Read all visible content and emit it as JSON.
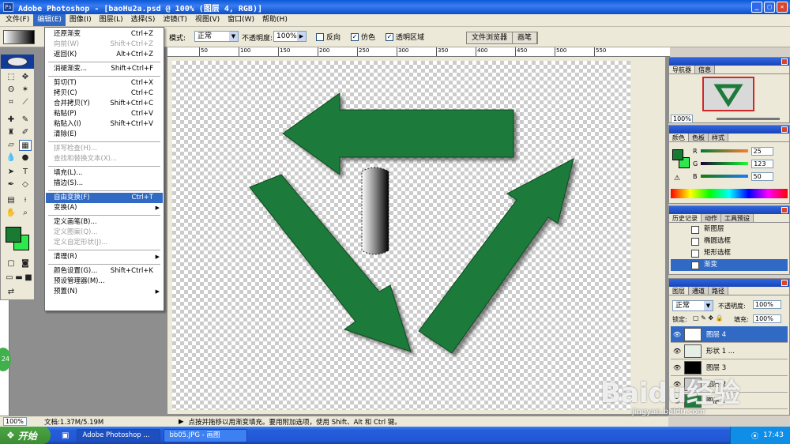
{
  "window": {
    "title": "Adobe Photoshop - [baoHu2a.psd @ 100% (图层 4, RGB)]"
  },
  "menubar": {
    "items": [
      "文件(F)",
      "编辑(E)",
      "图像(I)",
      "图层(L)",
      "选择(S)",
      "滤镜(T)",
      "视图(V)",
      "窗口(W)",
      "帮助(H)"
    ]
  },
  "options": {
    "mode_label": "模式:",
    "mode_value": "正常",
    "opacity_label": "不透明度:",
    "opacity_value": "100%",
    "reverse_label": "反向",
    "dither_label": "仿色",
    "transparency_label": "透明区域",
    "browser_label": "文件浏览器",
    "brushes_label": "画笔"
  },
  "edit_menu": [
    {
      "label": "还原渐变",
      "shortcut": "Ctrl+Z",
      "enabled": true
    },
    {
      "label": "向前(W)",
      "shortcut": "Shift+Ctrl+Z",
      "enabled": false
    },
    {
      "label": "返回(K)",
      "shortcut": "Alt+Ctrl+Z",
      "enabled": true
    },
    {
      "sep": true
    },
    {
      "label": "消褪渐变...",
      "shortcut": "Shift+Ctrl+F",
      "enabled": true
    },
    {
      "sep": true
    },
    {
      "label": "剪切(T)",
      "shortcut": "Ctrl+X",
      "enabled": true
    },
    {
      "label": "拷贝(C)",
      "shortcut": "Ctrl+C",
      "enabled": true
    },
    {
      "label": "合并拷贝(Y)",
      "shortcut": "Shift+Ctrl+C",
      "enabled": true
    },
    {
      "label": "粘贴(P)",
      "shortcut": "Ctrl+V",
      "enabled": true
    },
    {
      "label": "粘贴入(I)",
      "shortcut": "Shift+Ctrl+V",
      "enabled": true
    },
    {
      "label": "清除(E)",
      "shortcut": "",
      "enabled": true
    },
    {
      "sep": true
    },
    {
      "label": "拼写检查(H)...",
      "shortcut": "",
      "enabled": false
    },
    {
      "label": "查找和替换文本(X)...",
      "shortcut": "",
      "enabled": false
    },
    {
      "sep": true
    },
    {
      "label": "填充(L)...",
      "shortcut": "",
      "enabled": true
    },
    {
      "label": "描边(S)...",
      "shortcut": "",
      "enabled": true
    },
    {
      "sep": true
    },
    {
      "label": "自由变换(F)",
      "shortcut": "Ctrl+T",
      "enabled": true,
      "highlight": true
    },
    {
      "label": "变换(A)",
      "shortcut": "",
      "enabled": true,
      "submenu": true
    },
    {
      "sep": true
    },
    {
      "label": "定义画笔(B)...",
      "shortcut": "",
      "enabled": true
    },
    {
      "label": "定义图案(Q)...",
      "shortcut": "",
      "enabled": false
    },
    {
      "label": "定义自定形状(J)...",
      "shortcut": "",
      "enabled": false
    },
    {
      "sep": true
    },
    {
      "label": "清理(R)",
      "shortcut": "",
      "enabled": true,
      "submenu": true
    },
    {
      "sep": true
    },
    {
      "label": "颜色设置(G)...",
      "shortcut": "Shift+Ctrl+K",
      "enabled": true
    },
    {
      "label": "预设管理器(M)...",
      "shortcut": "",
      "enabled": true
    },
    {
      "label": "预置(N)",
      "shortcut": "",
      "enabled": true,
      "submenu": true
    }
  ],
  "ruler_ticks": [
    "50",
    "100",
    "150",
    "200",
    "250",
    "300",
    "350",
    "400",
    "450",
    "500",
    "550"
  ],
  "navigator": {
    "tabs": [
      "导航器",
      "信息"
    ],
    "zoom": "100%"
  },
  "color_panel": {
    "tabs": [
      "颜色",
      "色板",
      "样式"
    ],
    "channels": [
      {
        "label": "R",
        "value": "25"
      },
      {
        "label": "G",
        "value": "123"
      },
      {
        "label": "B",
        "value": "50"
      }
    ],
    "foreground": "#197b32"
  },
  "history_panel": {
    "tabs": [
      "历史记录",
      "动作",
      "工具预设"
    ],
    "items": [
      "新图层",
      "椭圆选框",
      "矩形选框",
      "渐变"
    ]
  },
  "layers_panel": {
    "tabs": [
      "图层",
      "通道",
      "路径"
    ],
    "blend": "正常",
    "opacity_label": "不透明度:",
    "opacity": "100%",
    "lock_label": "锁定:",
    "fill_label": "填充:",
    "fill": "100%",
    "layers": [
      "图层 4",
      "形状 1 ...",
      "图层 3",
      "图层 2",
      "图层 1"
    ]
  },
  "status": {
    "zoom": "100%",
    "doc": "文档:1.37M/5.19M",
    "hint": "点按并拖移以用渐变填充。要用附加选项，使用 Shift、Alt 和 Ctrl 键。"
  },
  "taskbar": {
    "start": "开始",
    "tasks": [
      "Adobe Photoshop ...",
      "bb05.JPG - 画图"
    ],
    "time": "17:43"
  },
  "watermark": {
    "brand": "Baidu经验",
    "url": "jingyan.baidu.com"
  },
  "badge": "24"
}
